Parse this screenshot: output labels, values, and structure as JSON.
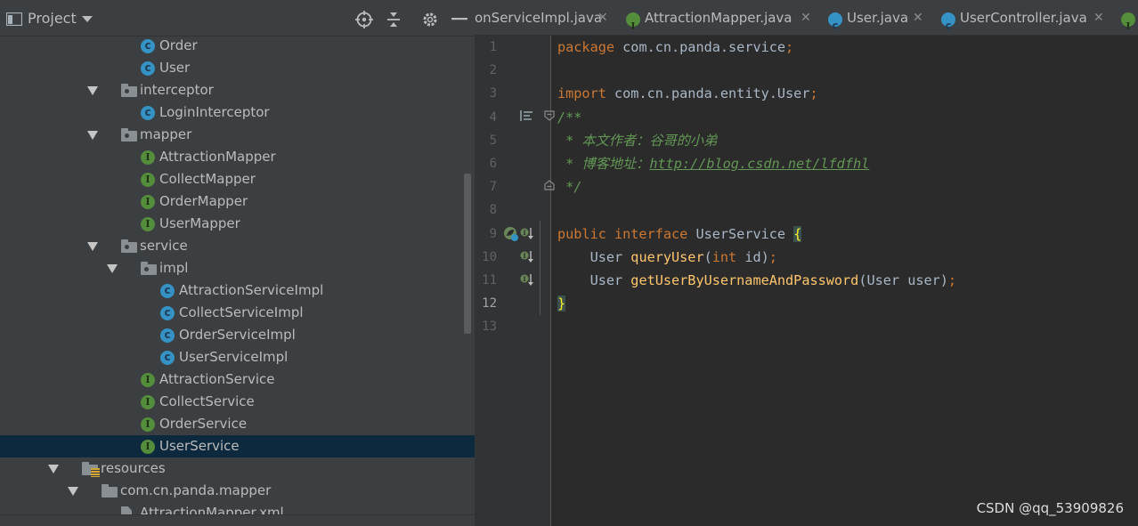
{
  "project_panel": {
    "title": "Project",
    "tree": [
      {
        "label": "Order",
        "type": "class",
        "depth": 2,
        "arrow": false
      },
      {
        "label": "User",
        "type": "class",
        "depth": 2,
        "arrow": false
      },
      {
        "label": "interceptor",
        "type": "package",
        "depth": 1,
        "arrow": true
      },
      {
        "label": "LoginInterceptor",
        "type": "class",
        "depth": 2,
        "arrow": false
      },
      {
        "label": "mapper",
        "type": "package",
        "depth": 1,
        "arrow": true
      },
      {
        "label": "AttractionMapper",
        "type": "interface",
        "depth": 2,
        "arrow": false
      },
      {
        "label": "CollectMapper",
        "type": "interface",
        "depth": 2,
        "arrow": false
      },
      {
        "label": "OrderMapper",
        "type": "interface",
        "depth": 2,
        "arrow": false
      },
      {
        "label": "UserMapper",
        "type": "interface",
        "depth": 2,
        "arrow": false
      },
      {
        "label": "service",
        "type": "package",
        "depth": 1,
        "arrow": true
      },
      {
        "label": "impl",
        "type": "package",
        "depth": 2,
        "arrow": true
      },
      {
        "label": "AttractionServiceImpl",
        "type": "class",
        "depth": 3,
        "arrow": false
      },
      {
        "label": "CollectServiceImpl",
        "type": "class",
        "depth": 3,
        "arrow": false
      },
      {
        "label": "OrderServiceImpl",
        "type": "class",
        "depth": 3,
        "arrow": false
      },
      {
        "label": "UserServiceImpl",
        "type": "class",
        "depth": 3,
        "arrow": false
      },
      {
        "label": "AttractionService",
        "type": "interface",
        "depth": 2,
        "arrow": false
      },
      {
        "label": "CollectService",
        "type": "interface",
        "depth": 2,
        "arrow": false
      },
      {
        "label": "OrderService",
        "type": "interface",
        "depth": 2,
        "arrow": false
      },
      {
        "label": "UserService",
        "type": "interface",
        "depth": 2,
        "arrow": false,
        "selected": true
      },
      {
        "label": "resources",
        "type": "resources",
        "depth": -1,
        "arrow": true
      },
      {
        "label": "com.cn.panda.mapper",
        "type": "folder",
        "depth": 0,
        "arrow": true
      },
      {
        "label": "AttractionMapper.xml",
        "type": "xml",
        "depth": 1,
        "arrow": false
      }
    ]
  },
  "tabs": [
    {
      "label": "onServiceImpl.java",
      "type": "none",
      "close": "✕"
    },
    {
      "label": "AttractionMapper.java",
      "type": "interface",
      "close": "✕"
    },
    {
      "label": "User.java",
      "type": "class",
      "close": "✕"
    },
    {
      "label": "UserController.java",
      "type": "class",
      "close": "✕"
    },
    {
      "label": "",
      "type": "interface",
      "close": ""
    }
  ],
  "editor": {
    "line_numbers": [
      "1",
      "2",
      "3",
      "4",
      "5",
      "6",
      "7",
      "8",
      "9",
      "10",
      "11",
      "12",
      "13"
    ],
    "current_line": 12,
    "lines": [
      [
        {
          "t": "package",
          "c": "kw"
        },
        {
          "t": " com.cn.panda.service",
          "c": ""
        },
        {
          "t": ";",
          "c": "kw"
        }
      ],
      [],
      [
        {
          "t": "import",
          "c": "kw"
        },
        {
          "t": " com.cn.panda.entity.User",
          "c": ""
        },
        {
          "t": ";",
          "c": "kw"
        }
      ],
      [
        {
          "t": "/**",
          "c": "cmt"
        }
      ],
      [
        {
          "t": " * 本文作者：谷哥的小弟",
          "c": "cmt"
        }
      ],
      [
        {
          "t": " * 博客地址：",
          "c": "cmt"
        },
        {
          "t": "http://blog.csdn.net/lfdfhl",
          "c": "url"
        }
      ],
      [
        {
          "t": " */",
          "c": "cmt"
        }
      ],
      [],
      [
        {
          "t": "public interface",
          "c": "kw"
        },
        {
          "t": " UserService ",
          "c": ""
        },
        {
          "t": "{",
          "c": "brace"
        }
      ],
      [
        {
          "t": "    User ",
          "c": ""
        },
        {
          "t": "queryUser",
          "c": "fn"
        },
        {
          "t": "(",
          "c": ""
        },
        {
          "t": "int",
          "c": "kw"
        },
        {
          "t": " id)",
          "c": ""
        },
        {
          "t": ";",
          "c": "kw"
        }
      ],
      [
        {
          "t": "    User ",
          "c": ""
        },
        {
          "t": "getUserByUsernameAndPassword",
          "c": "fn"
        },
        {
          "t": "(User user)",
          "c": ""
        },
        {
          "t": ";",
          "c": "kw"
        }
      ],
      [
        {
          "t": "}",
          "c": "brace"
        }
      ],
      []
    ]
  },
  "watermark": "CSDN @qq_53909826",
  "colors": {
    "keyword": "#cc7832",
    "comment": "#629755",
    "method": "#ffc66d",
    "text": "#a9b7c6",
    "selection": "#0d293e"
  }
}
